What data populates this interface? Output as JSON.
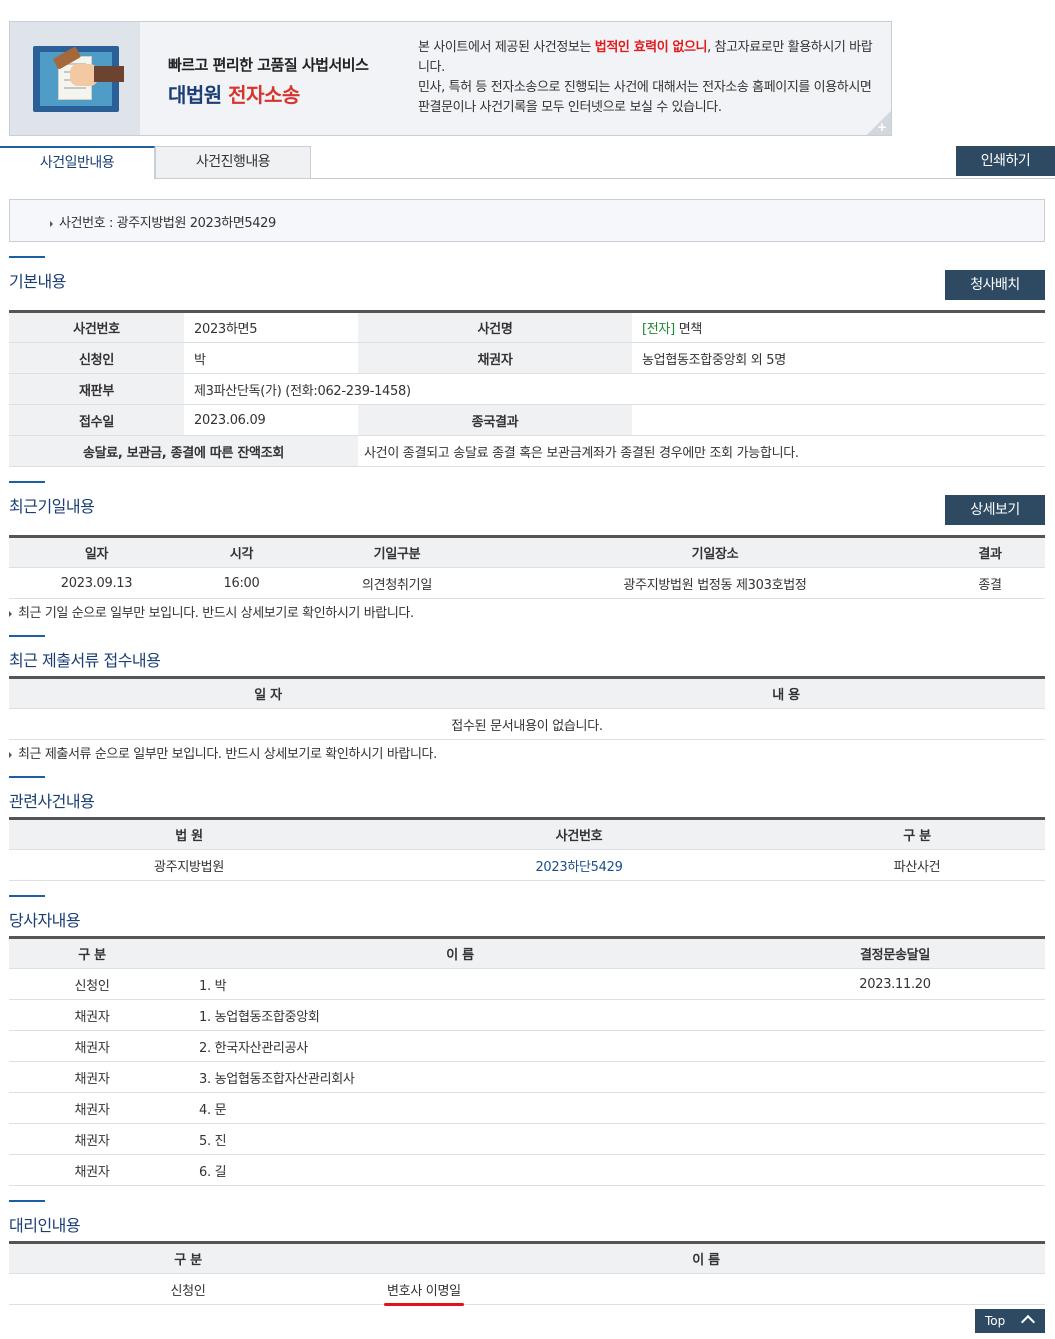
{
  "banner": {
    "subtitle": "빠르고 편리한 고품질 사법서비스",
    "title_brand": "대법원",
    "title_service": "전자소송",
    "notice_pre": "본 사이트에서 제공된 사건정보는 ",
    "notice_warn": "법적인 효력이 없으니",
    "notice_post": ", 참고자료로만 활용하시기 바랍니다.",
    "notice_line2": "민사, 특허 등 전자소송으로 진행되는 사건에 대해서는 전자소송 홈페이지를 이용하시면 판결문이나 사건기록을 모두 인터넷으로 보실 수 있습니다.",
    "corner_label": "+"
  },
  "tabs": [
    {
      "label": "사건일반내용",
      "active": true
    },
    {
      "label": "사건진행내용",
      "active": false
    }
  ],
  "print_button": "인쇄하기",
  "case_header": "사건번호 : 광주지방법원 2023하면5429",
  "basic": {
    "title": "기본내용",
    "button": "청사배치",
    "labels": {
      "case_no": "사건번호",
      "case_name": "사건명",
      "applicant": "신청인",
      "creditor": "채권자",
      "court_division": "재판부",
      "received": "접수일",
      "final_result": "종국결과",
      "balance_inquiry": "송달료, 보관금, 종결에 따른 잔액조회"
    },
    "values": {
      "case_no": "2023하면5",
      "case_name_tag": "[전자]",
      "case_name": "면책",
      "applicant": "박",
      "creditor": "농업협동조합중앙회 외 5명",
      "court_division": "제3파산단독(가) (전화:062-239-1458)",
      "received": "2023.06.09",
      "final_result": "",
      "balance_inquiry": "사건이 종결되고 송달료 종결 혹은 보관금계좌가 종결된 경우에만 조회 가능합니다."
    }
  },
  "hearings": {
    "title": "최근기일내용",
    "button": "상세보기",
    "columns": [
      "일자",
      "시각",
      "기일구분",
      "기일장소",
      "결과"
    ],
    "rows": [
      [
        "2023.09.13",
        "16:00",
        "의견청취기일",
        "광주지방법원 법정동 제303호법정",
        "종결"
      ]
    ],
    "note": "최근 기일 순으로 일부만 보입니다. 반드시 상세보기로 확인하시기 바랍니다."
  },
  "filings": {
    "title": "최근 제출서류 접수내용",
    "columns": [
      "일 자",
      "내 용"
    ],
    "empty": "접수된 문서내용이 없습니다.",
    "note": "최근 제출서류 순으로 일부만 보입니다. 반드시 상세보기로 확인하시기 바랍니다."
  },
  "related": {
    "title": "관련사건내용",
    "columns": [
      "법 원",
      "사건번호",
      "구 분"
    ],
    "rows": [
      [
        "광주지방법원",
        "2023하단5429",
        "파산사건"
      ]
    ]
  },
  "parties": {
    "title": "당사자내용",
    "columns": [
      "구 분",
      "이 름",
      "결정문송달일"
    ],
    "rows": [
      [
        "신청인",
        "1. 박",
        "2023.11.20"
      ],
      [
        "채권자",
        "1. 농업협동조합중앙회",
        ""
      ],
      [
        "채권자",
        "2. 한국자산관리공사",
        ""
      ],
      [
        "채권자",
        "3. 농업협동조합자산관리회사",
        ""
      ],
      [
        "채권자",
        "4. 문",
        ""
      ],
      [
        "채권자",
        "5. 진",
        ""
      ],
      [
        "채권자",
        "6. 길",
        ""
      ]
    ]
  },
  "agents": {
    "title": "대리인내용",
    "columns": [
      "구 분",
      "이 름"
    ],
    "rows": [
      [
        "신청인",
        "변호사 이명일"
      ]
    ]
  },
  "top_button": "Top"
}
